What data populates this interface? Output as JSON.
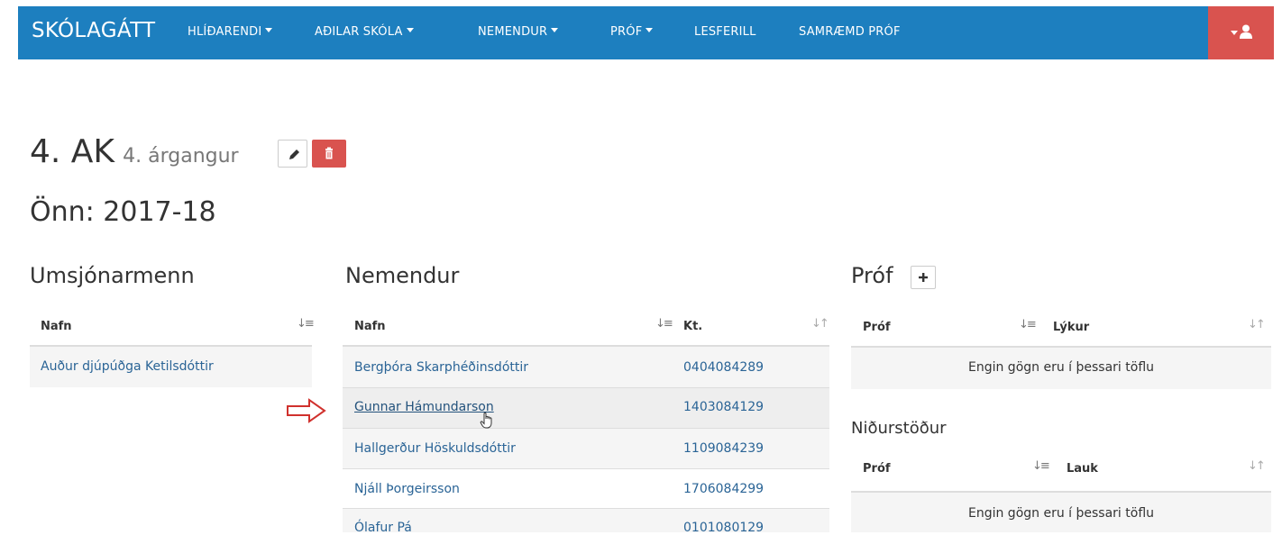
{
  "navbar": {
    "brand": "SKÓLAGÁTT",
    "items": [
      {
        "label": "HLÍÐARENDI",
        "dropdown": true
      },
      {
        "label": "AÐILAR SKÓLA",
        "dropdown": true
      },
      {
        "label": "NEMENDUR",
        "dropdown": true
      },
      {
        "label": "PRÓF",
        "dropdown": true
      },
      {
        "label": "LESFERILL",
        "dropdown": false
      },
      {
        "label": "SAMRÆMD PRÓF",
        "dropdown": false
      }
    ],
    "user_icon": "user-icon",
    "colors": {
      "bar": "#1d7fbf",
      "user_button": "#d9534f"
    }
  },
  "header": {
    "class_name": "4. AK",
    "grade": "4. árgangur",
    "edit_icon": "pencil-icon",
    "delete_icon": "trash-icon",
    "term": "Önn: 2017-18"
  },
  "supervisors": {
    "title": "Umsjónarmenn",
    "column": "Nafn",
    "rows": [
      "Auður djúpúðga Ketilsdóttir"
    ]
  },
  "students": {
    "title": "Nemendur",
    "columns": {
      "name": "Nafn",
      "kt": "Kt."
    },
    "rows": [
      {
        "name": "Bergþóra Skarphéðinsdóttir",
        "kt": "0404084289"
      },
      {
        "name": "Gunnar Hámundarson",
        "kt": "1403084129"
      },
      {
        "name": "Hallgerður Höskuldsdóttir",
        "kt": "1109084239"
      },
      {
        "name": "Njáll Þorgeirsson",
        "kt": "1706084299"
      },
      {
        "name": "Ólafur Pá",
        "kt": "0101080129"
      }
    ]
  },
  "exams": {
    "title": "Próf",
    "add_icon": "plus-icon",
    "columns": {
      "exam": "Próf",
      "ends": "Lýkur"
    },
    "empty": "Engin gögn eru í þessari töflu"
  },
  "results": {
    "title": "Niðurstöður",
    "columns": {
      "exam": "Próf",
      "finished": "Lauk"
    },
    "empty": "Engin gögn eru í þessari töflu"
  },
  "annotation": {
    "arrow_color": "#d0312d"
  }
}
